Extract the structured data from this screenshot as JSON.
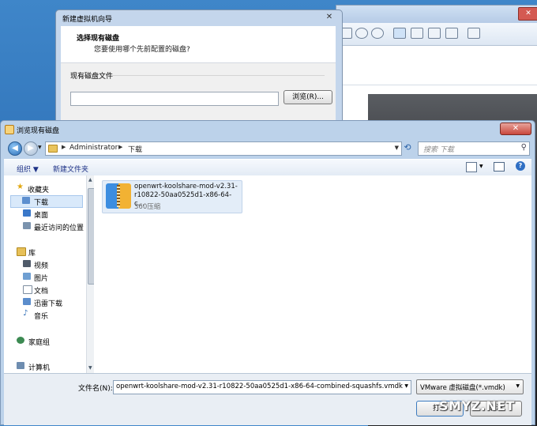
{
  "wizard": {
    "title": "新建虚拟机向导",
    "close": "✕",
    "heading": "选择现有磁盘",
    "subheading": "您要使用哪个先前配置的磁盘?",
    "group_label": "现有磁盘文件",
    "path_value": "",
    "browse_button": "浏览(R)..."
  },
  "browse": {
    "title": "浏览现有磁盘",
    "close": "✕",
    "back": "◀",
    "forward": "▶",
    "breadcrumb": [
      "Administrator",
      "下载"
    ],
    "search_placeholder": "搜索 下载",
    "toolbar": {
      "organize": "组织 ▼",
      "new_folder": "新建文件夹"
    },
    "nav": {
      "favorites": "收藏夹",
      "downloads": "下载",
      "desktop": "桌面",
      "recent": "最近访问的位置",
      "library": "库",
      "videos": "视频",
      "pictures": "图片",
      "documents": "文档",
      "xunlei": "迅雷下载",
      "music": "音乐",
      "homegroup": "家庭组",
      "computer": "计算机"
    },
    "files": [
      {
        "name": "openwrt-koolshare-mod-v2.31-r10822-50aa0525d1-x86-64-c...",
        "type": "360压缩"
      }
    ],
    "filename_label": "文件名(N):",
    "filename_value": "openwrt-koolshare-mod-v2.31-r10822-50aa0525d1-x86-64-combined-squashfs.vmdk",
    "filetype_value": "VMware 虚拟磁盘(*.vmdk)",
    "open_button": "打开",
    "cancel_button": "取消"
  },
  "watermark": "SMYZ.NET",
  "colors": {
    "desktop": "#2a6cb3",
    "selection": "#d9e9fa",
    "link_text": "#1e3287"
  }
}
